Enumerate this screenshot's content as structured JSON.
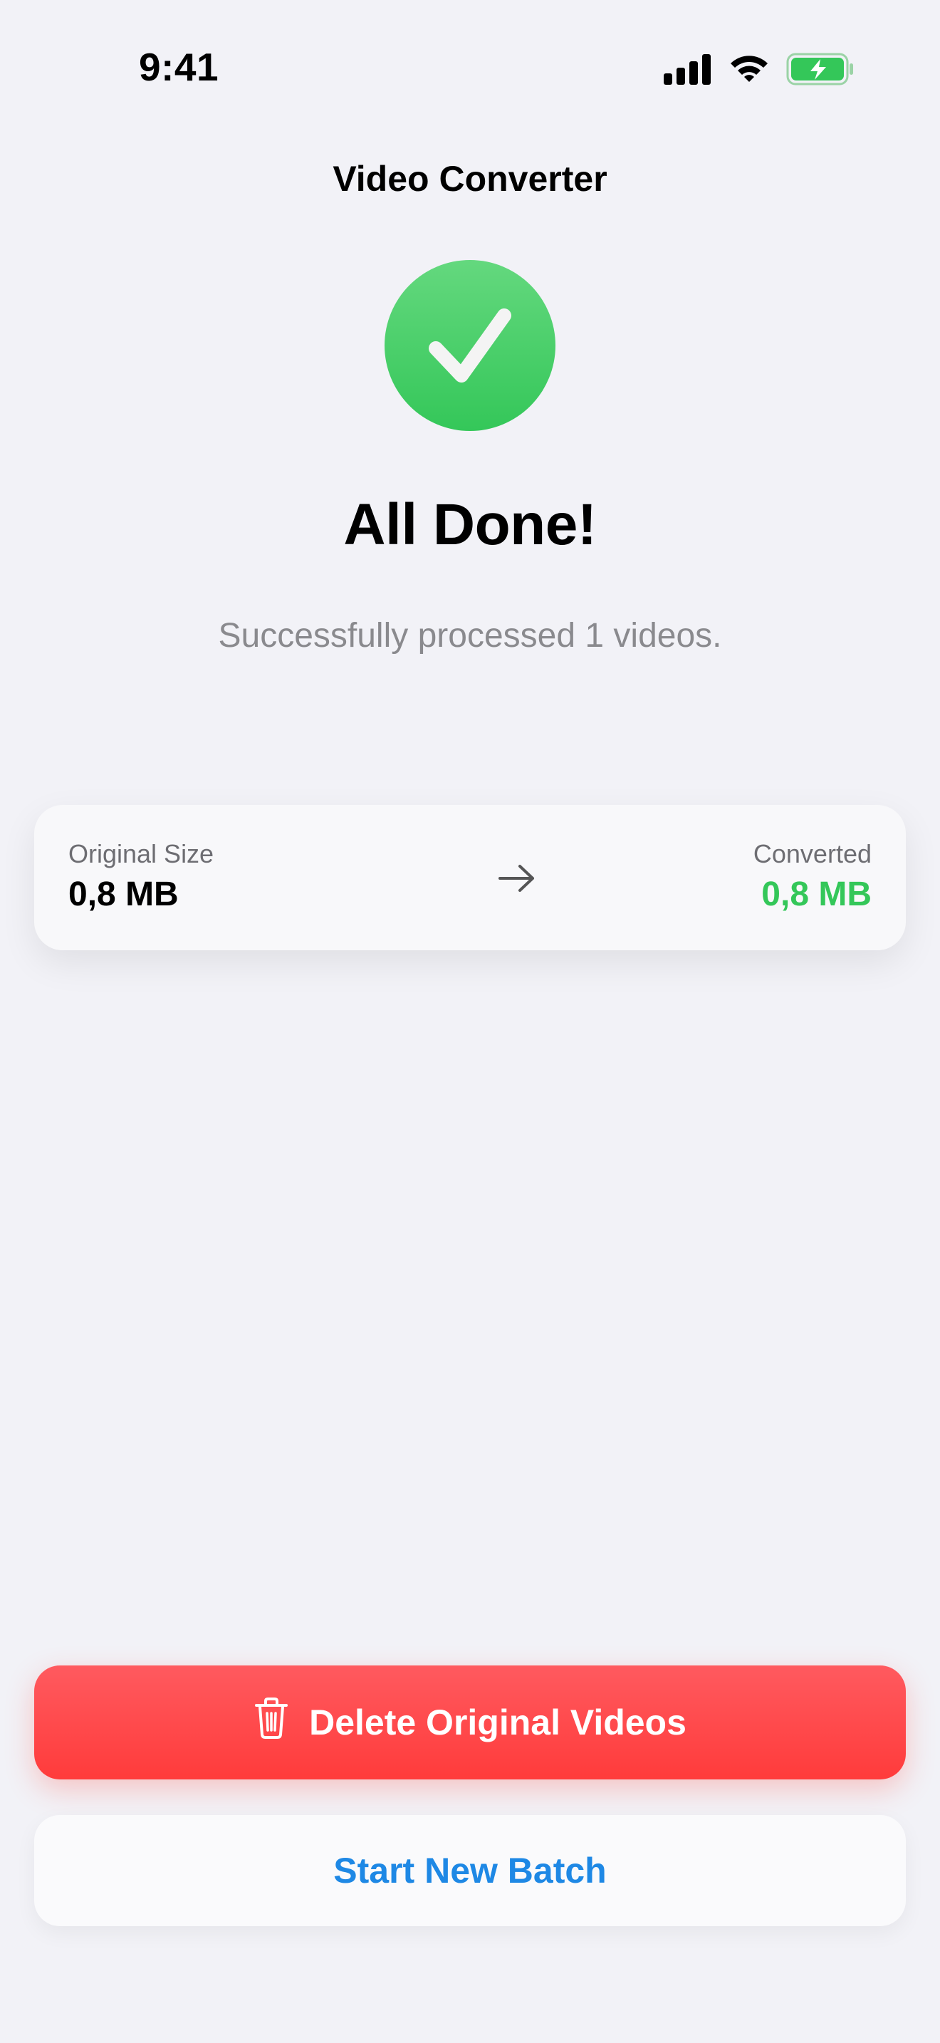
{
  "status_bar": {
    "time": "9:41",
    "icons": [
      "cellular-signal-icon",
      "wifi-icon",
      "battery-charging-icon"
    ],
    "battery_color": "#34c759"
  },
  "nav": {
    "title": "Video Converter"
  },
  "result": {
    "icon": "checkmark-circle-icon",
    "icon_color": "#34c759",
    "headline": "All Done!",
    "subtitle": "Successfully processed 1 videos."
  },
  "size_card": {
    "original_label": "Original Size",
    "original_value": "0,8 MB",
    "arrow_icon": "arrow-right-icon",
    "converted_label": "Converted",
    "converted_value": "0,8 MB",
    "converted_color": "#34c759"
  },
  "actions": {
    "delete_label": "Delete Original Videos",
    "delete_icon": "trash-icon",
    "delete_color": "#ff3b30",
    "new_batch_label": "Start New Batch",
    "new_batch_color": "#1e88e5"
  }
}
